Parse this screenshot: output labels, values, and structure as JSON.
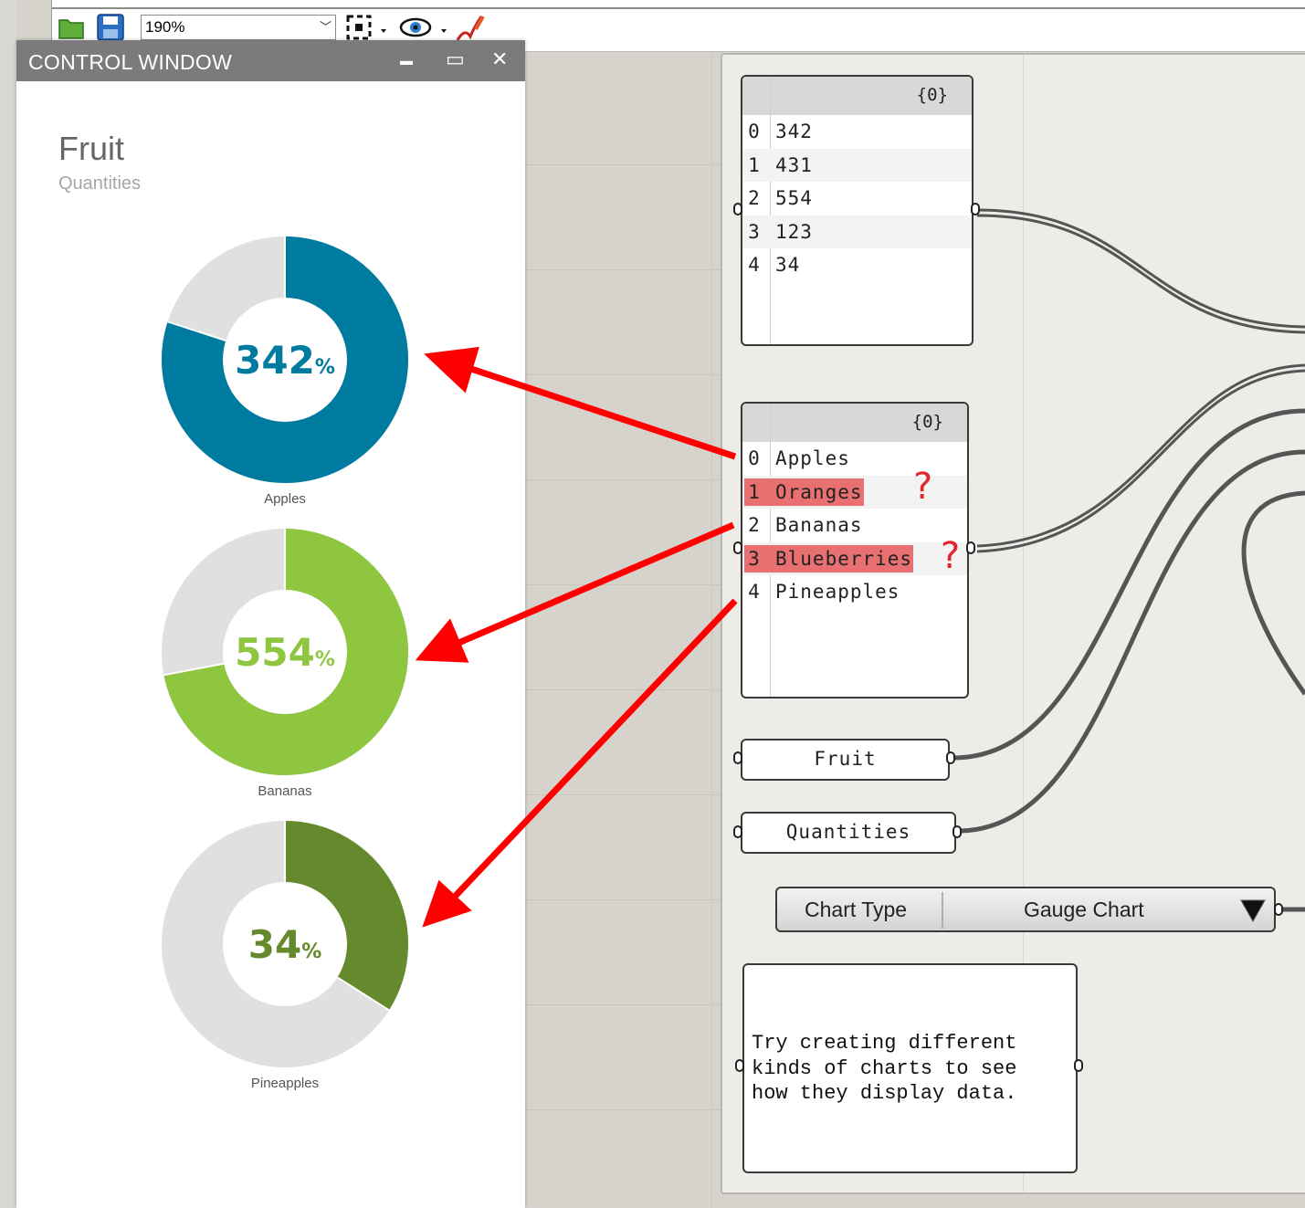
{
  "toolbar": {
    "zoom_value": "190%",
    "icons": [
      "open-folder-icon",
      "save-icon",
      "zoom-extents-icon",
      "preview-eye-icon",
      "sketch-pen-icon"
    ]
  },
  "control_window": {
    "title": "CONTROL WINDOW",
    "minimize_glyph": "▬",
    "maximize_glyph": "▭",
    "close_glyph": "✕"
  },
  "chart_data": {
    "type": "gauge",
    "title": "Fruit",
    "subtitle": "Quantities",
    "unit_suffix": "%",
    "gauges": [
      {
        "label": "Apples",
        "value": 342,
        "display": "342",
        "fill_fraction": 0.8,
        "color": "#007ba0"
      },
      {
        "label": "Bananas",
        "value": 554,
        "display": "554",
        "fill_fraction": 0.72,
        "color": "#8ec63f"
      },
      {
        "label": "Pineapples",
        "value": 34,
        "display": "34",
        "fill_fraction": 0.34,
        "color": "#648a2d"
      }
    ],
    "track_color": "#e0e0e0"
  },
  "numbers_panel": {
    "header": "{0}",
    "rows": [
      {
        "index": "0",
        "value": "342"
      },
      {
        "index": "1",
        "value": "431"
      },
      {
        "index": "2",
        "value": "554"
      },
      {
        "index": "3",
        "value": "123"
      },
      {
        "index": "4",
        "value": "34"
      }
    ]
  },
  "names_panel": {
    "header": "{0}",
    "rows": [
      {
        "index": "0",
        "value": "Apples",
        "highlight": false
      },
      {
        "index": "1",
        "value": "Oranges",
        "highlight": true
      },
      {
        "index": "2",
        "value": "Bananas",
        "highlight": false
      },
      {
        "index": "3",
        "value": "Blueberries",
        "highlight": true
      },
      {
        "index": "4",
        "value": "Pineapples",
        "highlight": false
      }
    ],
    "question_mark": "?"
  },
  "fruit_panel": {
    "text": "Fruit"
  },
  "quantities_panel": {
    "text": "Quantities"
  },
  "chart_type": {
    "label": "Chart Type",
    "value": "Gauge Chart"
  },
  "note": {
    "text": "Try creating different\nkinds of charts to see\nhow they display data."
  },
  "colors": {
    "arrow": "#ff0000",
    "highlight": "#e87070",
    "wire": "#555555"
  }
}
